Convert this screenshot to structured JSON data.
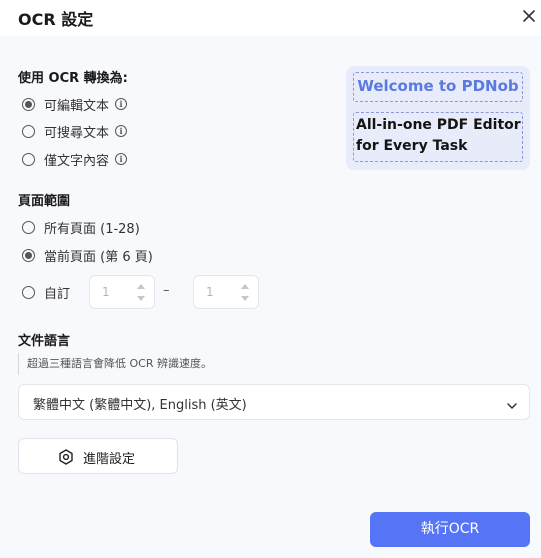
{
  "dialog": {
    "title": "OCR 設定"
  },
  "convert": {
    "heading": "使用 OCR 轉換為:",
    "options": [
      {
        "label": "可編輯文本",
        "checked": true
      },
      {
        "label": "可搜尋文本",
        "checked": false
      },
      {
        "label": "僅文字內容",
        "checked": false
      }
    ]
  },
  "preview": {
    "line1": "Welcome to PDNob",
    "line2a": "All-in-one PDF Editor",
    "line2b": "for Every Task"
  },
  "range": {
    "heading": "頁面範圍",
    "all": "所有頁面 (1-28)",
    "current": "當前頁面 (第 6 頁)",
    "custom": "自訂",
    "current_checked": true,
    "from_value": "1",
    "to_value": "1",
    "separator": "–"
  },
  "language": {
    "heading": "文件語言",
    "hint": "超過三種語言會降低 OCR 辨識速度。",
    "selected": "繁體中文 (繁體中文), English (英文)"
  },
  "buttons": {
    "advanced": "進階設定",
    "run": "執行OCR"
  },
  "colors": {
    "accent": "#5574f6",
    "preview_bg": "#e8ecfa",
    "preview_text": "#5b7ae0"
  }
}
